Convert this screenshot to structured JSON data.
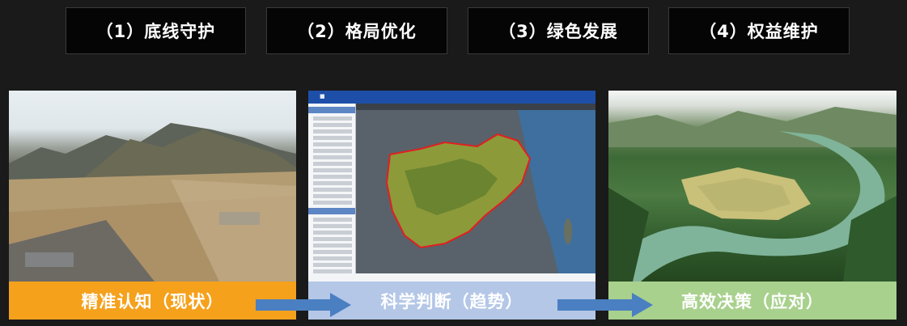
{
  "tabs": [
    {
      "label": "（1）底线守护"
    },
    {
      "label": "（2）格局优化"
    },
    {
      "label": "（3）绿色发展"
    },
    {
      "label": "（4）权益维护"
    }
  ],
  "panels": [
    {
      "caption": "精准认知（现状）",
      "caption_color": "#f5a11c"
    },
    {
      "caption": "科学判断（趋势）",
      "caption_color": "#b4c7e7"
    },
    {
      "caption": "高效决策（应对）",
      "caption_color": "#a9d18e"
    }
  ],
  "arrow_color": "#4a7fc1"
}
